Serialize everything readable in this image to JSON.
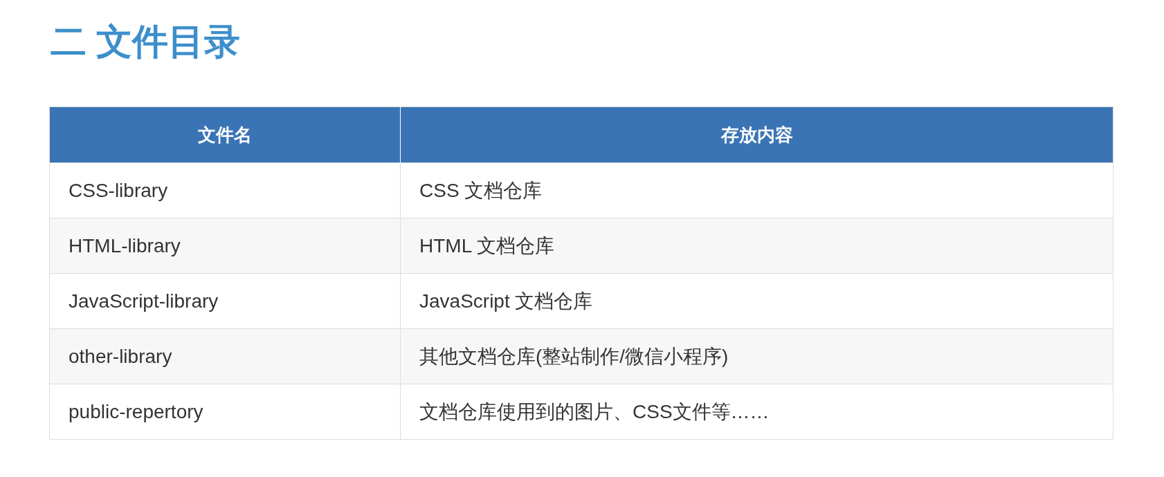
{
  "heading": "二 文件目录",
  "table": {
    "columns": [
      "文件名",
      "存放内容"
    ],
    "rows": [
      [
        "CSS-library",
        "CSS 文档仓库"
      ],
      [
        "HTML-library",
        "HTML 文档仓库"
      ],
      [
        "JavaScript-library",
        "JavaScript 文档仓库"
      ],
      [
        "other-library",
        "其他文档仓库(整站制作/微信小程序)"
      ],
      [
        "public-repertory",
        "文档仓库使用到的图片、CSS文件等……"
      ]
    ]
  }
}
